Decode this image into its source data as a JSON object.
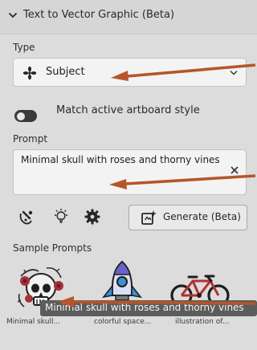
{
  "header": {
    "title": "Text to Vector Graphic (Beta)"
  },
  "type_section": {
    "label": "Type",
    "selected": "Subject",
    "icon": "subject-icon"
  },
  "match_toggle": {
    "label": "Match active artboard style",
    "on": false
  },
  "prompt_section": {
    "label": "Prompt",
    "value": "Minimal skull with roses and thorny vines"
  },
  "tools": {
    "icons": [
      "style-picker-icon",
      "lightbulb-icon",
      "settings-icon"
    ]
  },
  "generate_button": {
    "label": "Generate (Beta)"
  },
  "samples": {
    "label": "Sample Prompts",
    "items": [
      {
        "caption": "Minimal skull...",
        "icon": "skull-roses-image"
      },
      {
        "caption": "colorful space...",
        "icon": "rocket-image"
      },
      {
        "caption": "illustration of...",
        "icon": "bicycle-image"
      }
    ],
    "tooltip": "Minimal skull with roses and thorny vines"
  },
  "colors": {
    "annotation_arrow": "#b5562a",
    "panel_bg": "#dcdcdc"
  }
}
